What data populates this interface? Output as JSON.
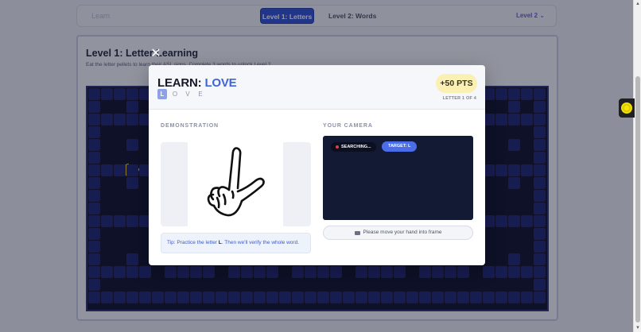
{
  "nav": {
    "brand": "Learn",
    "tabs": [
      {
        "label": "Level 1: Letters",
        "active": true
      },
      {
        "label": "Level 2: Words",
        "active": false
      }
    ],
    "level_indicator": "Level 2 ⌄"
  },
  "level": {
    "title": "Level 1: Letter Learning",
    "subtitle": "Eat the letter pellets to learn their ASL signs. Complete 3 words to unlock Level 2."
  },
  "modal": {
    "close_label": "✕",
    "learn_prefix": "LEARN:",
    "word": "LOVE",
    "letters": [
      "L",
      "O",
      "V",
      "E"
    ],
    "current_letter_index": 0,
    "points": "+50 PTS",
    "progress": "LETTER 1 OF 4",
    "demonstration_label": "DEMONSTRATION",
    "camera_label": "YOUR CAMERA",
    "tip_prefix": "Tip: Practice the letter",
    "tip_letter": "L",
    "tip_suffix": ". Then we'll verify the whole word.",
    "camera_status": "SEARCHING...",
    "camera_target": "TARGET: L",
    "camera_message": "Please move your hand into frame"
  },
  "icons": {
    "close": "close-icon",
    "camera": "camera-icon",
    "recording": "recording-dot-icon",
    "widget": "spark-icon"
  },
  "colors": {
    "accent": "#3d63dd",
    "points_badge": "#fbf0b4",
    "camera_bg": "#131a34",
    "board_bg": "#0a0c24",
    "pacman": "#f0d020"
  }
}
